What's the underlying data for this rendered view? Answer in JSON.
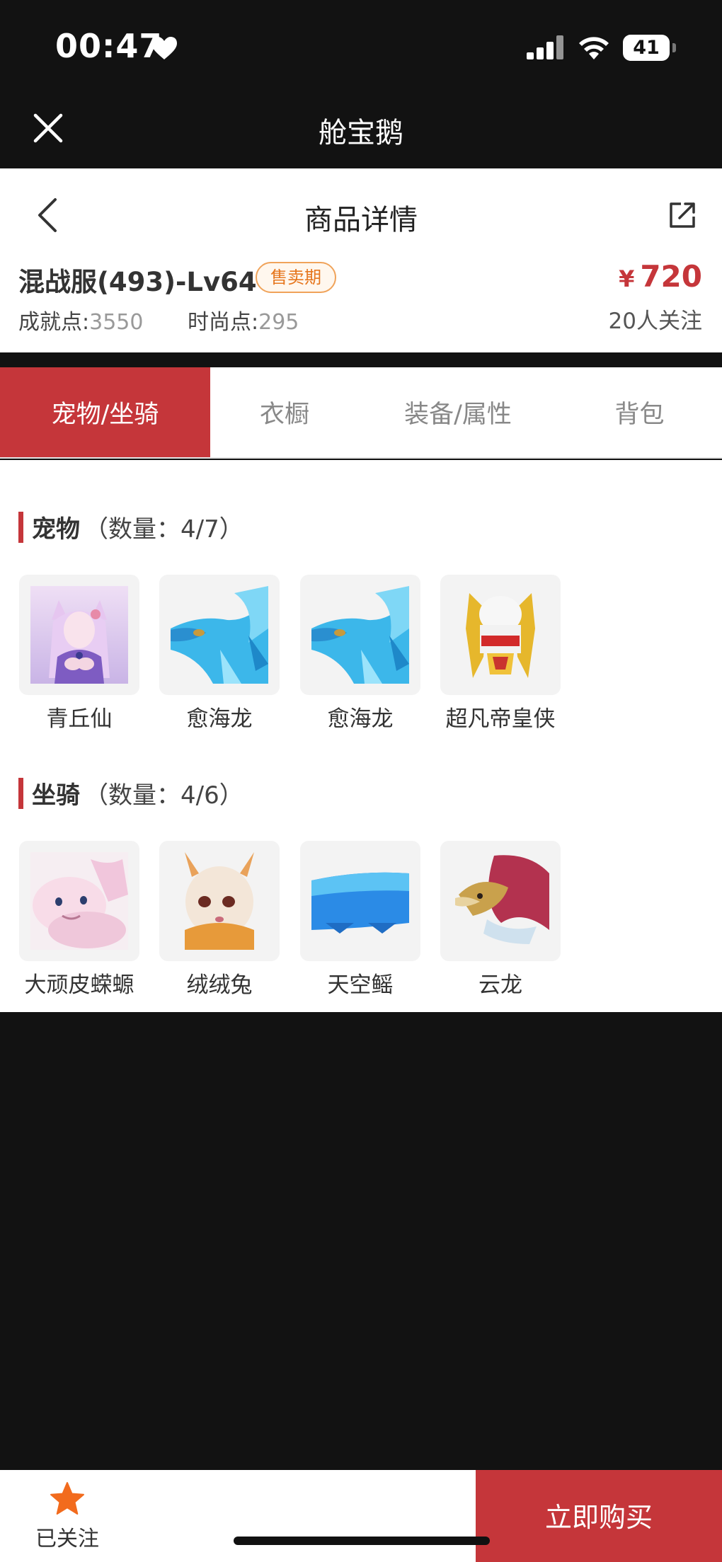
{
  "status_bar": {
    "time": "00:47",
    "battery": "41"
  },
  "app_bar": {
    "title": "舱宝鹅"
  },
  "header": {
    "title": "商品详情",
    "product_name": "混战服(493)-Lv64",
    "badge": "售卖期",
    "price_symbol": "¥",
    "price": "720",
    "achievement_label": "成就点:",
    "achievement_value": "3550",
    "fashion_label": "时尚点:",
    "fashion_value": "295",
    "followers": "20人关注"
  },
  "tabs": [
    {
      "label": "宠物/坐骑",
      "active": true
    },
    {
      "label": "衣橱",
      "active": false
    },
    {
      "label": "装备/属性",
      "active": false
    },
    {
      "label": "背包",
      "active": false
    }
  ],
  "pets": {
    "title": "宠物",
    "count": "（数量：4/7）",
    "items": [
      {
        "name": "青丘仙",
        "icon": "fox-fairy-icon"
      },
      {
        "name": "愈海龙",
        "icon": "sea-dragon-icon"
      },
      {
        "name": "愈海龙",
        "icon": "sea-dragon-icon"
      },
      {
        "name": "超凡帝皇侠",
        "icon": "golden-armor-icon"
      }
    ]
  },
  "mounts": {
    "title": "坐骑",
    "count": "（数量：4/6）",
    "items": [
      {
        "name": "大顽皮蝾螈",
        "icon": "axolotl-icon"
      },
      {
        "name": "绒绒兔",
        "icon": "rabbit-icon"
      },
      {
        "name": "天空鳐",
        "icon": "sky-ray-icon"
      },
      {
        "name": "云龙",
        "icon": "cloud-dragon-icon"
      }
    ]
  },
  "bottom_bar": {
    "follow_label": "已关注",
    "buy_label": "立即购买"
  },
  "colors": {
    "accent": "#c5363a",
    "star": "#f26b1d",
    "badge": "#e6761d"
  }
}
